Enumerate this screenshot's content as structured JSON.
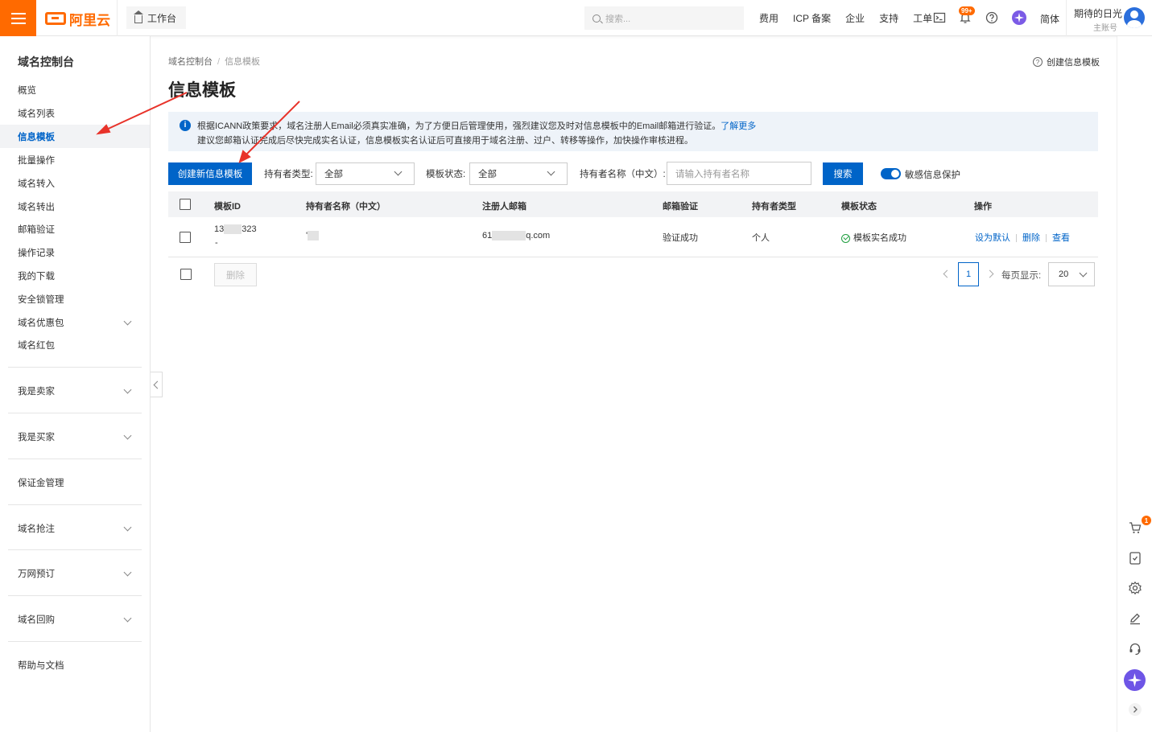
{
  "header": {
    "logo_text": "阿里云",
    "workbench_label": "工作台",
    "search_placeholder": "搜索...",
    "nav": [
      "费用",
      "ICP 备案",
      "企业",
      "支持",
      "工单"
    ],
    "notification_badge": "99+",
    "language": "简体",
    "user_name": "期待的日光",
    "user_role": "主账号"
  },
  "sidebar": {
    "title": "域名控制台",
    "items": [
      {
        "label": "概览"
      },
      {
        "label": "域名列表"
      },
      {
        "label": "信息模板",
        "active": true
      },
      {
        "label": "批量操作"
      },
      {
        "label": "域名转入"
      },
      {
        "label": "域名转出"
      },
      {
        "label": "邮箱验证"
      },
      {
        "label": "操作记录"
      },
      {
        "label": "我的下载"
      },
      {
        "label": "安全锁管理"
      },
      {
        "label": "域名优惠包",
        "expandable": true
      },
      {
        "label": "域名红包"
      }
    ],
    "groups": [
      {
        "label": "我是卖家",
        "expandable": true
      },
      {
        "label": "我是买家",
        "expandable": true
      },
      {
        "label": "保证金管理",
        "expandable": false
      },
      {
        "label": "域名抢注",
        "expandable": true
      },
      {
        "label": "万网预订",
        "expandable": true
      },
      {
        "label": "域名回购",
        "expandable": true
      },
      {
        "label": "帮助与文档",
        "expandable": false
      }
    ]
  },
  "main": {
    "breadcrumb": [
      "域名控制台",
      "信息模板"
    ],
    "title": "信息模板",
    "help_link": "创建信息模板",
    "notice": {
      "line1": "根据ICANN政策要求，域名注册人Email必须真实准确，为了方便日后管理使用，强烈建议您及时对信息模板中的Email邮箱进行验证。",
      "line1_link": "了解更多",
      "line2": "建议您邮箱认证完成后尽快完成实名认证，信息模板实名认证后可直接用于域名注册、过户、转移等操作，加快操作审核进程。"
    },
    "toolbar": {
      "create_button": "创建新信息模板",
      "holder_type_label": "持有者类型:",
      "holder_type_value": "全部",
      "template_status_label": "模板状态:",
      "template_status_value": "全部",
      "holder_name_label": "持有者名称（中文）:",
      "holder_name_placeholder": "请输入持有者名称",
      "search_button": "搜索",
      "sensitive_toggle_label": "敏感信息保护"
    },
    "table": {
      "columns": [
        "模板ID",
        "持有者名称（中文）",
        "注册人邮箱",
        "邮箱验证",
        "持有者类型",
        "模板状态",
        "操作"
      ],
      "rows": [
        {
          "id_prefix": "13",
          "id_suffix": "323",
          "id_sub": "-",
          "holder_name": "'",
          "email_prefix": "61",
          "email_suffix": "q.com",
          "email_verify": "验证成功",
          "holder_type": "个人",
          "status": "模板实名成功",
          "actions": [
            "设为默认",
            "删除",
            "查看"
          ]
        }
      ]
    },
    "footer": {
      "delete_button": "删除",
      "current_page": "1",
      "page_size_label": "每页显示:",
      "page_size": "20"
    }
  },
  "rail": {
    "cart_badge": "1"
  },
  "colors": {
    "brand": "#ff6a00",
    "primary": "#0064c8",
    "success": "#1e9e3e",
    "annotation": "#e8332a"
  }
}
